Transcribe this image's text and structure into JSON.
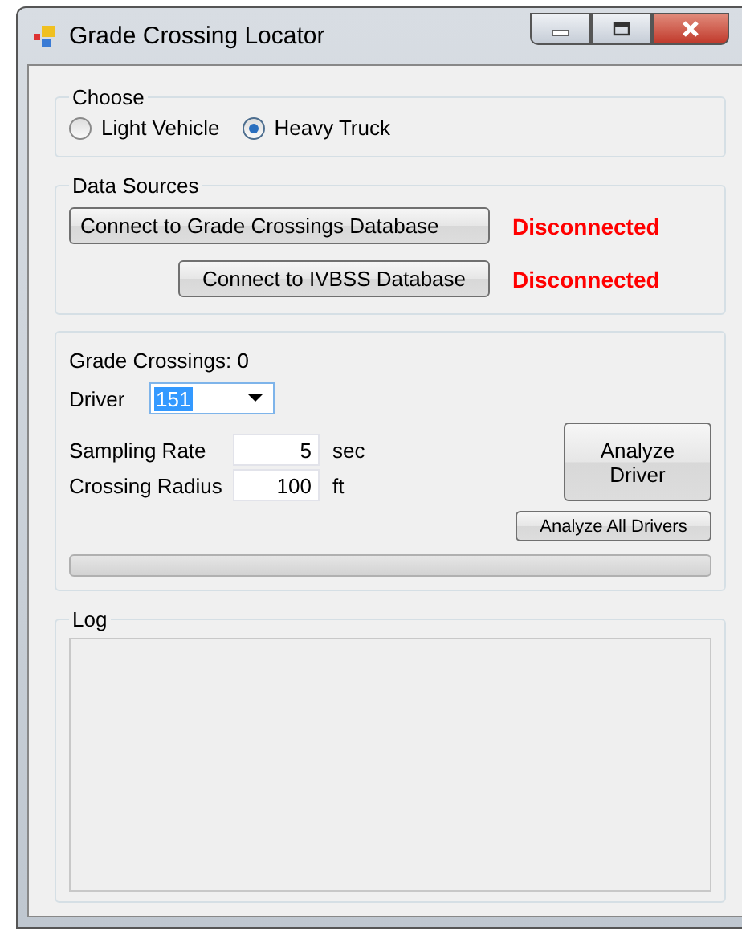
{
  "window": {
    "title": "Grade Crossing Locator"
  },
  "choose": {
    "title": "Choose",
    "options": [
      {
        "label": "Light Vehicle",
        "selected": false
      },
      {
        "label": "Heavy Truck",
        "selected": true
      }
    ]
  },
  "data_sources": {
    "title": "Data Sources",
    "connections": [
      {
        "button": "Connect to Grade Crossings Database",
        "status": "Disconnected"
      },
      {
        "button": "Connect to IVBSS Database",
        "status": "Disconnected"
      }
    ]
  },
  "analysis": {
    "grade_crossings": "Grade Crossings: 0",
    "driver_label": "Driver",
    "driver_value": "151",
    "fields": [
      {
        "label": "Sampling Rate",
        "value": "5",
        "unit": "sec"
      },
      {
        "label": "Crossing Radius",
        "value": "100",
        "unit": "ft"
      }
    ],
    "analyze_button": "Analyze Driver",
    "analyze_all_button": "Analyze All Drivers",
    "progress": {
      "level": 0
    }
  },
  "log": {
    "title": "Log"
  }
}
